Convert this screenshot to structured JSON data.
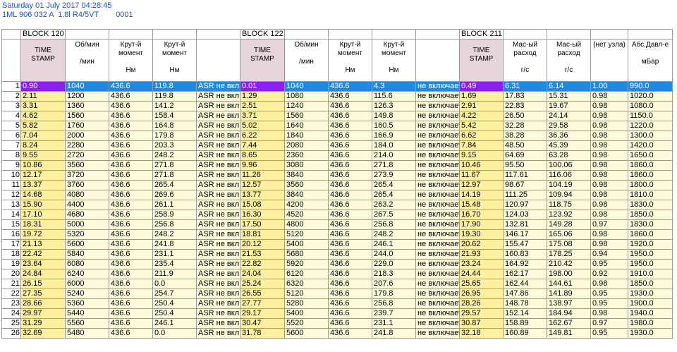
{
  "header": {
    "datetime": "Saturday 01 July 2017 04:28:45",
    "engine": "1ML 906 032 A  1.8l R4/5VT",
    "code": "0001"
  },
  "blocks": [
    "BLOCK 120",
    "BLOCK 122",
    "BLOCK 211"
  ],
  "columns": [
    {
      "l1": "TIME",
      "l2": "STAMP",
      "l3": ""
    },
    {
      "l1": "Об/мин",
      "l2": "",
      "l3": "/мин"
    },
    {
      "l1": "Крут-й",
      "l2": "момент",
      "l3": "Нм"
    },
    {
      "l1": "Крут-й",
      "l2": "момент",
      "l3": "Нм"
    },
    {
      "l1": "",
      "l2": "",
      "l3": ""
    },
    {
      "l1": "TIME",
      "l2": "STAMP",
      "l3": ""
    },
    {
      "l1": "Об/мин",
      "l2": "",
      "l3": "/мин"
    },
    {
      "l1": "Крут-й",
      "l2": "момент",
      "l3": "Нм"
    },
    {
      "l1": "Крут-й",
      "l2": "момент",
      "l3": "Нм"
    },
    {
      "l1": "",
      "l2": "",
      "l3": ""
    },
    {
      "l1": "TIME",
      "l2": "STAMP",
      "l3": ""
    },
    {
      "l1": "Мас-ый",
      "l2": "расход",
      "l3": "г/с"
    },
    {
      "l1": "Мас-ый",
      "l2": "расход",
      "l3": "г/с"
    },
    {
      "l1": "(нет узла)",
      "l2": "",
      "l3": ""
    },
    {
      "l1": "Абс.Давл-е",
      "l2": "",
      "l3": "мБар"
    }
  ],
  "rows": [
    [
      "1",
      "0.90",
      "1040",
      "436.6",
      "119.8",
      "ASR не вкл",
      "0.01",
      "1040",
      "436.6",
      "4.3",
      "не включает",
      "0.49",
      "6.31",
      "6.14",
      "1.00",
      "990.0"
    ],
    [
      "2",
      "2.11",
      "1200",
      "436.6",
      "119.8",
      "ASR не вкл",
      "1.29",
      "1080",
      "436.6",
      "115.6",
      "не включает",
      "1.69",
      "17.83",
      "15.31",
      "0.98",
      "1020.0"
    ],
    [
      "3",
      "3.31",
      "1360",
      "436.6",
      "141.2",
      "ASR не вкл",
      "2.51",
      "1240",
      "436.6",
      "126.3",
      "не включает",
      "2.91",
      "22.83",
      "19.67",
      "0.98",
      "1080.0"
    ],
    [
      "4",
      "4.62",
      "1560",
      "436.6",
      "158.4",
      "ASR не вкл",
      "3.71",
      "1560",
      "436.6",
      "149.8",
      "не включает",
      "4.22",
      "26.50",
      "24.14",
      "0.98",
      "1150.0"
    ],
    [
      "5",
      "5.82",
      "1760",
      "436.6",
      "164.8",
      "ASR не вкл",
      "5.02",
      "1640",
      "436.6",
      "160.5",
      "не включает",
      "5.42",
      "32.28",
      "29.58",
      "0.98",
      "1220.0"
    ],
    [
      "6",
      "7.04",
      "2000",
      "436.6",
      "179.8",
      "ASR не вкл",
      "6.22",
      "1840",
      "436.6",
      "166.9",
      "не включает",
      "6.62",
      "38.28",
      "36.36",
      "0.98",
      "1300.0"
    ],
    [
      "7",
      "8.24",
      "2280",
      "436.6",
      "203.3",
      "ASR не вкл",
      "7.44",
      "2080",
      "436.6",
      "184.0",
      "не включает",
      "7.84",
      "48.50",
      "45.39",
      "0.98",
      "1420.0"
    ],
    [
      "8",
      "9.55",
      "2720",
      "436.6",
      "248.2",
      "ASR не вкл",
      "8.65",
      "2360",
      "436.6",
      "214.0",
      "не включает",
      "9.15",
      "64.69",
      "63.28",
      "0.98",
      "1650.0"
    ],
    [
      "9",
      "10.86",
      "3560",
      "436.6",
      "271.8",
      "ASR не вкл",
      "9.96",
      "3080",
      "436.6",
      "271.8",
      "не включает",
      "10.46",
      "95.50",
      "100.06",
      "0.98",
      "1860.0"
    ],
    [
      "10",
      "12.17",
      "3720",
      "436.6",
      "271.8",
      "ASR не вкл",
      "11.26",
      "3840",
      "436.6",
      "273.9",
      "не включает",
      "11.67",
      "117.61",
      "116.06",
      "0.98",
      "1860.0"
    ],
    [
      "11",
      "13.37",
      "3760",
      "436.6",
      "265.4",
      "ASR не вкл",
      "12.57",
      "3560",
      "436.6",
      "265.4",
      "не включает",
      "12.97",
      "98.67",
      "104.19",
      "0.98",
      "1800.0"
    ],
    [
      "12",
      "14.68",
      "4080",
      "436.6",
      "269.6",
      "ASR не вкл",
      "13.77",
      "3840",
      "436.6",
      "265.4",
      "не включает",
      "14.19",
      "111.25",
      "109.94",
      "0.98",
      "1810.0"
    ],
    [
      "13",
      "15.90",
      "4400",
      "436.6",
      "261.1",
      "ASR не вкл",
      "15.08",
      "4200",
      "436.6",
      "263.2",
      "не включает",
      "15.48",
      "120.97",
      "118.75",
      "0.98",
      "1830.0"
    ],
    [
      "14",
      "17.10",
      "4680",
      "436.6",
      "258.9",
      "ASR не вкл",
      "16.30",
      "4520",
      "436.6",
      "267.5",
      "не включает",
      "16.70",
      "124.03",
      "123.92",
      "0.98",
      "1850.0"
    ],
    [
      "15",
      "18.31",
      "5000",
      "436.6",
      "256.8",
      "ASR не вкл",
      "17.50",
      "4800",
      "436.6",
      "256.8",
      "не включает",
      "17.90",
      "132.81",
      "149.28",
      "0.97",
      "1830.0"
    ],
    [
      "16",
      "19.72",
      "5320",
      "436.6",
      "248.2",
      "ASR не вкл",
      "18.81",
      "5120",
      "436.6",
      "248.2",
      "не включает",
      "19.30",
      "146.17",
      "165.06",
      "0.98",
      "1860.0"
    ],
    [
      "17",
      "21.13",
      "5600",
      "436.6",
      "241.8",
      "ASR не вкл",
      "20.12",
      "5400",
      "436.6",
      "246.1",
      "не включает",
      "20.62",
      "155.47",
      "175.08",
      "0.98",
      "1920.0"
    ],
    [
      "18",
      "22.42",
      "5840",
      "436.6",
      "231.1",
      "ASR не вкл",
      "21.53",
      "5680",
      "436.6",
      "244.0",
      "не включает",
      "21.93",
      "160.83",
      "178.25",
      "0.94",
      "1950.0"
    ],
    [
      "19",
      "23.64",
      "6080",
      "436.6",
      "235.4",
      "ASR не вкл",
      "22.82",
      "5920",
      "436.6",
      "229.0",
      "не включает",
      "23.24",
      "164.92",
      "210.42",
      "0.95",
      "1950.0"
    ],
    [
      "20",
      "24.84",
      "6240",
      "436.6",
      "211.9",
      "ASR не вкл",
      "24.04",
      "6120",
      "436.6",
      "218.3",
      "не включает",
      "24.44",
      "162.17",
      "198.00",
      "0.92",
      "1910.0"
    ],
    [
      "21",
      "26.15",
      "6000",
      "436.6",
      "0.0",
      "ASR не вкл",
      "25.24",
      "6320",
      "436.6",
      "207.6",
      "не включает",
      "25.65",
      "162.44",
      "144.61",
      "0.98",
      "1850.0"
    ],
    [
      "22",
      "27.35",
      "5240",
      "436.6",
      "254.7",
      "ASR не вкл",
      "26.55",
      "5120",
      "436.6",
      "179.8",
      "не включает",
      "26.95",
      "147.86",
      "141.89",
      "0.95",
      "1930.0"
    ],
    [
      "23",
      "28.66",
      "5360",
      "436.6",
      "250.4",
      "ASR не вкл",
      "27.77",
      "5280",
      "436.6",
      "256.8",
      "не включает",
      "28.26",
      "148.78",
      "138.97",
      "0.95",
      "1900.0"
    ],
    [
      "24",
      "29.97",
      "5440",
      "436.6",
      "250.4",
      "ASR не вкл",
      "29.17",
      "5400",
      "436.6",
      "239.7",
      "не включает",
      "29.57",
      "152.14",
      "184.94",
      "0.98",
      "1940.0"
    ],
    [
      "25",
      "31.29",
      "5560",
      "436.6",
      "246.1",
      "ASR не вкл",
      "30.47",
      "5520",
      "436.6",
      "231.1",
      "не включает",
      "30.87",
      "158.89",
      "162.67",
      "0.97",
      "1980.0"
    ],
    [
      "26",
      "32.69",
      "5480",
      "436.6",
      "0.0",
      "ASR не вкл",
      "31.78",
      "5600",
      "436.6",
      "241.8",
      "не включает",
      "32.18",
      "160.89",
      "149.81",
      "0.95",
      "1930.0"
    ]
  ],
  "selected_row": 0
}
